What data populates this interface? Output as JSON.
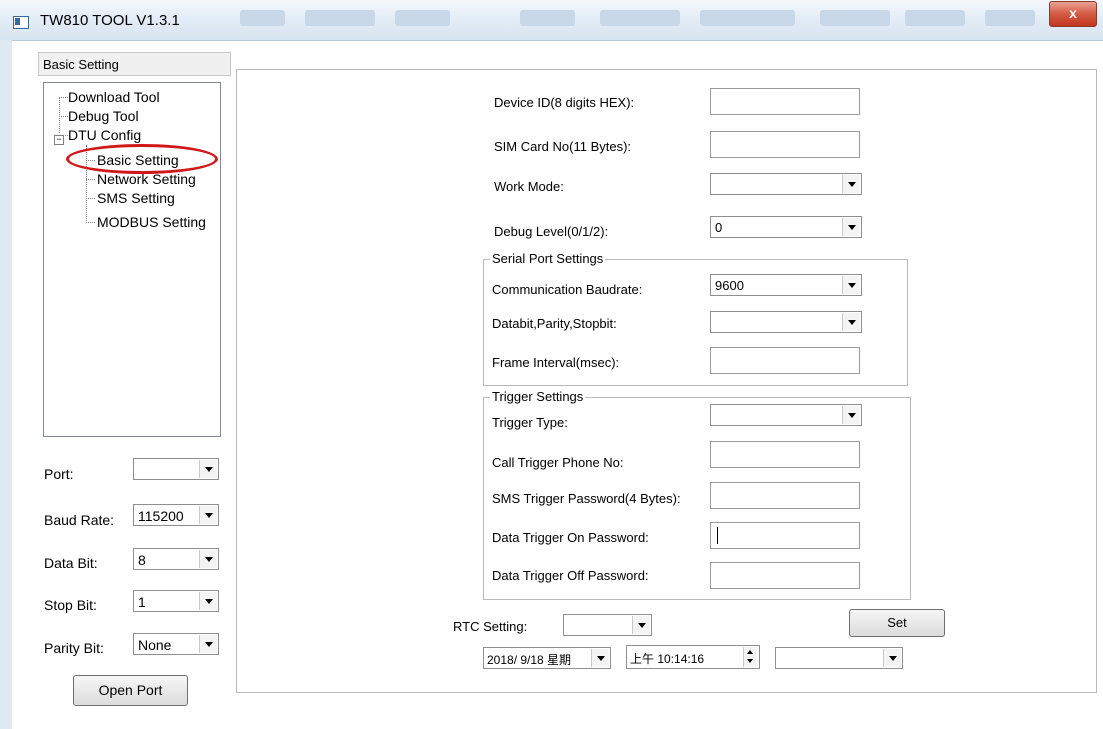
{
  "window": {
    "title": "TW810 TOOL V1.3.1",
    "close_glyph": "x"
  },
  "left": {
    "selected_header": "Basic Setting",
    "tree": [
      {
        "label": "Download Tool"
      },
      {
        "label": "Debug Tool"
      },
      {
        "label": "DTU Config"
      },
      {
        "label": "Basic Setting"
      },
      {
        "label": "Network Setting"
      },
      {
        "label": "SMS Setting"
      },
      {
        "label": "MODBUS Setting"
      }
    ],
    "tree_expander_glyph": "−",
    "port": {
      "label": "Port:",
      "value": ""
    },
    "baud": {
      "label": "Baud Rate:",
      "value": "115200"
    },
    "databit": {
      "label": "Data Bit:",
      "value": "8"
    },
    "stopbit": {
      "label": "Stop Bit:",
      "value": "1"
    },
    "parity": {
      "label": "Parity Bit:",
      "value": "None"
    },
    "open_port": "Open Port"
  },
  "main": {
    "device_id": {
      "label": "Device ID(8 digits HEX):",
      "value": ""
    },
    "sim": {
      "label": "SIM Card No(11 Bytes):",
      "value": ""
    },
    "work_mode": {
      "label": "Work Mode:",
      "value": ""
    },
    "debug_level": {
      "label": "Debug Level(0/1/2):",
      "value": "0"
    },
    "serial": {
      "title": "Serial Port Settings",
      "baudrate": {
        "label": "Communication Baudrate:",
        "value": "9600"
      },
      "dps": {
        "label": "Databit,Parity,Stopbit:",
        "value": ""
      },
      "frame": {
        "label": "Frame Interval(msec):",
        "value": ""
      }
    },
    "trigger": {
      "title": "Trigger Settings",
      "type": {
        "label": "Trigger Type:",
        "value": ""
      },
      "call": {
        "label": "Call Trigger Phone No:",
        "value": ""
      },
      "sms": {
        "label": "SMS Trigger Password(4 Bytes):",
        "value": ""
      },
      "on": {
        "label": "Data Trigger On Password:",
        "value": ""
      },
      "off": {
        "label": "Data Trigger Off Password:",
        "value": ""
      }
    },
    "rtc": {
      "label": "RTC Setting:",
      "mode_value": "",
      "set": "Set",
      "date": "2018/ 9/18 星期",
      "time": "上午 10:14:16",
      "extra_value": ""
    }
  }
}
